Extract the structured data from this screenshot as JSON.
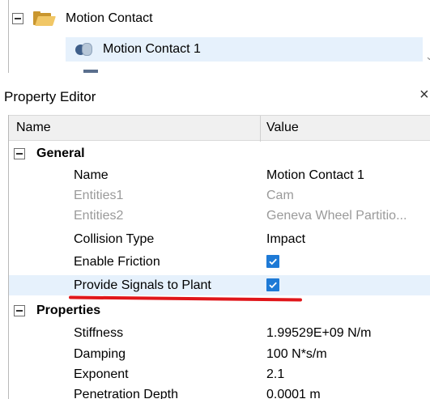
{
  "tree": {
    "parent_label": "Motion Contact",
    "child_label": "Motion Contact 1"
  },
  "property_editor": {
    "title": "Property Editor",
    "close_glyph": "×",
    "columns": {
      "name": "Name",
      "value": "Value"
    },
    "categories": [
      {
        "label": "General",
        "rows": [
          {
            "name": "Name",
            "value": "Motion Contact 1",
            "disabled": false
          },
          {
            "name": "Entities1",
            "value": "Cam",
            "disabled": true
          },
          {
            "name": "Entities2",
            "value": "Geneva Wheel Partitio...",
            "disabled": true
          },
          {
            "name": "Collision Type",
            "value": "Impact",
            "disabled": false
          },
          {
            "name": "Enable Friction",
            "checked": true
          },
          {
            "name": "Provide Signals to Plant",
            "checked": true,
            "selected": true,
            "highlighted": true
          }
        ]
      },
      {
        "label": "Properties",
        "rows": [
          {
            "name": "Stiffness",
            "value": "1.99529E+09 N/m"
          },
          {
            "name": "Damping",
            "value": "100 N*s/m"
          },
          {
            "name": "Exponent",
            "value": "2.1"
          },
          {
            "name": "Penetration Depth",
            "value": "0.0001 m"
          }
        ]
      }
    ]
  },
  "colors": {
    "selection_bg": "#e6f1fc",
    "checkbox_blue": "#1e7ad6",
    "annotation_red": "#e0161a",
    "disabled_text": "#9a9a9a"
  }
}
